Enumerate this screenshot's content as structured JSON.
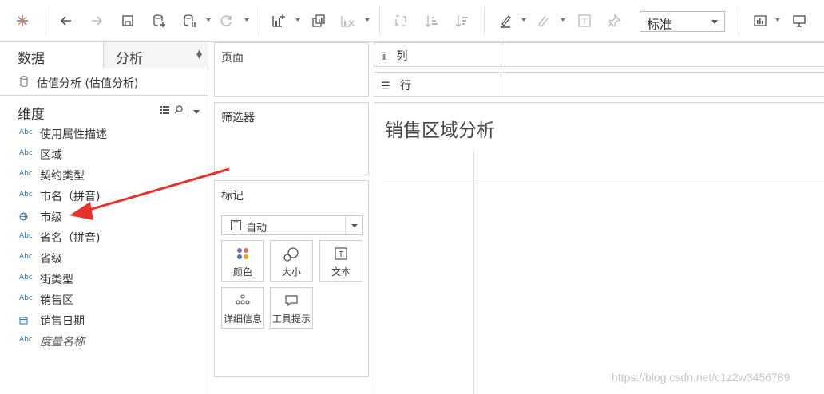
{
  "toolbar": {
    "view_size": "标准",
    "colors": {
      "logo": "#5b6fa8",
      "icon": "#555555",
      "icon_disabled": "#bbbbbb",
      "accent": "#2f73b5"
    }
  },
  "data_pane": {
    "tabs": [
      {
        "label": "数据",
        "active": true
      },
      {
        "label": "分析",
        "active": false
      }
    ],
    "datasource": "估值分析 (估值分析)",
    "dimensions_title": "维度",
    "fields": [
      {
        "type": "Abc",
        "name": "使用属性描述"
      },
      {
        "type": "Abc",
        "name": "区域"
      },
      {
        "type": "Abc",
        "name": "契约类型"
      },
      {
        "type": "Abc",
        "name": "市名（拼音)"
      },
      {
        "type": "globe",
        "name": "市级"
      },
      {
        "type": "Abc",
        "name": "省名（拼音)"
      },
      {
        "type": "Abc",
        "name": "省级"
      },
      {
        "type": "Abc",
        "name": "街类型"
      },
      {
        "type": "Abc",
        "name": "销售区"
      },
      {
        "type": "date",
        "name": "销售日期"
      },
      {
        "type": "Abc",
        "name": "度量名称",
        "italic": true
      }
    ]
  },
  "shelves": {
    "pages": "页面",
    "filters": "筛选器",
    "marks": {
      "title": "标记",
      "type": "自动",
      "buttons": [
        "颜色",
        "大小",
        "文本",
        "详细信息",
        "工具提示"
      ]
    },
    "columns": "列",
    "rows": "行"
  },
  "canvas": {
    "title": "销售区域分析",
    "watermark": "https://blog.csdn.net/c1z2w3456789",
    "annotation_color": "#e8312b"
  }
}
